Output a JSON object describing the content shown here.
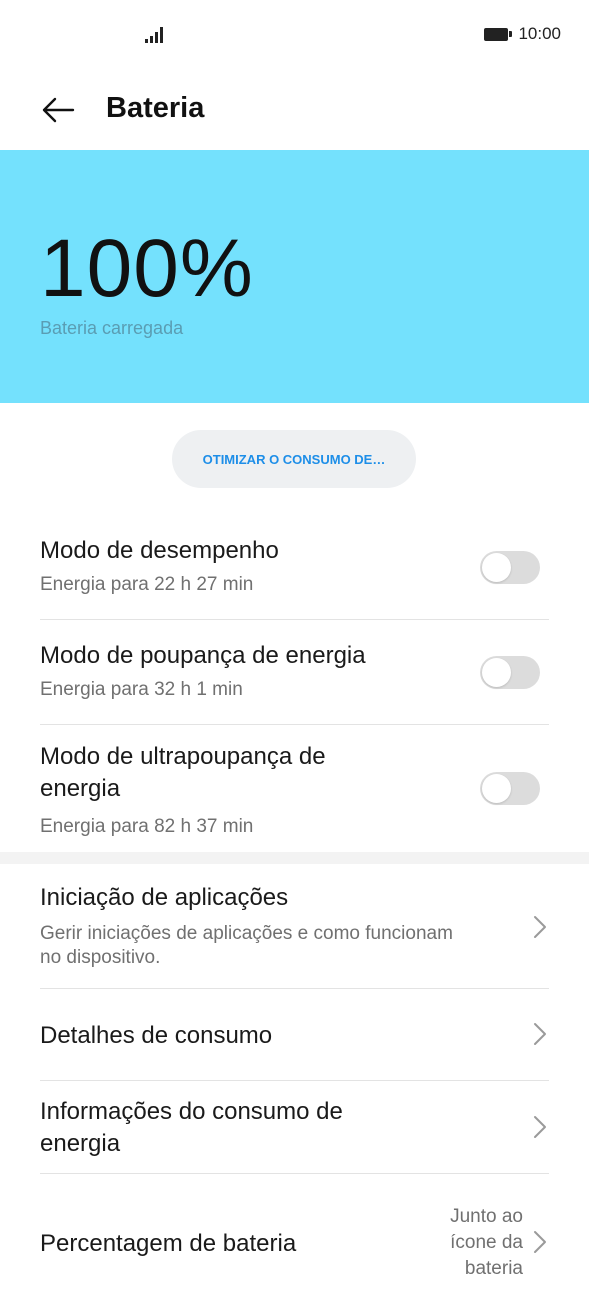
{
  "status_bar": {
    "time": "10:00"
  },
  "header": {
    "title": "Bateria"
  },
  "hero": {
    "percent": "100%",
    "status": "Bateria carregada",
    "background": "#74e1fd"
  },
  "optimize_button": {
    "label": "OTIMIZAR O CONSUMO DE…"
  },
  "modes": [
    {
      "title": "Modo de desempenho",
      "subtitle": "Energia para 22 h 27 min",
      "enabled": false
    },
    {
      "title": "Modo de poupança de energia",
      "subtitle": "Energia para 32 h 1 min",
      "enabled": false
    },
    {
      "title": "Modo de ultrapoupança de energia",
      "subtitle": "Energia para 82 h 37 min",
      "enabled": false
    }
  ],
  "settings": [
    {
      "title": "Iniciação de aplicações",
      "subtitle": "Gerir iniciações de aplicações e como funcionam no dispositivo."
    },
    {
      "title": "Detalhes de consumo"
    },
    {
      "title": "Informações do consumo de energia"
    },
    {
      "title": "Percentagem de bateria",
      "value": "Junto ao ícone da bateria"
    }
  ],
  "colors": {
    "accent": "#1d8ee8",
    "toggle_off": "#dcdcdc"
  }
}
